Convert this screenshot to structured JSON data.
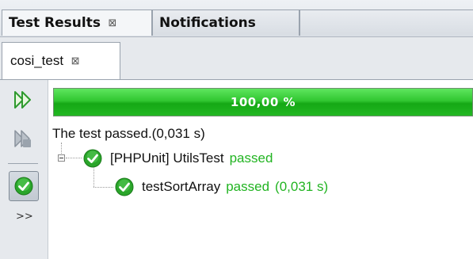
{
  "tabs": [
    {
      "label": "Test Results",
      "close": "⊠",
      "active": true
    },
    {
      "label": "Notifications",
      "active": false
    }
  ],
  "session_tab": {
    "label": "cosi_test",
    "close": "⊠"
  },
  "toolbar": {
    "buttons": [
      {
        "name": "rerun",
        "icon": "rerun-icon"
      },
      {
        "name": "rerun-failed",
        "icon": "rerun-failed-icon"
      },
      {
        "name": "show-passed",
        "icon": "check-icon",
        "pressed": true
      }
    ],
    "more_label": ">>"
  },
  "progress": {
    "label": "100,00 %",
    "fraction": 1.0,
    "color": "#22b422"
  },
  "summary": "The test passed.(0,031 s)",
  "tree": {
    "suite": {
      "label": "[PHPUnit] UtilsTest",
      "status": "passed"
    },
    "test": {
      "label": "testSortArray",
      "status": "passed",
      "time": "(0,031 s)"
    }
  },
  "colors": {
    "pass_text": "#22b422",
    "icon_green": "#2aa52a"
  }
}
